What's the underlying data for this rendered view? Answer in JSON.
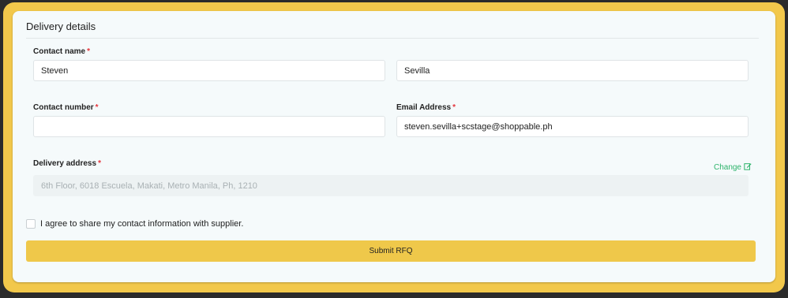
{
  "card": {
    "title": "Delivery details"
  },
  "fields": {
    "contact_name": {
      "label": "Contact name",
      "required_mark": "*",
      "first_value": "Steven",
      "last_value": "Sevilla"
    },
    "contact_number": {
      "label": "Contact number",
      "required_mark": "*",
      "value": ""
    },
    "email": {
      "label": "Email Address",
      "required_mark": "*",
      "value": "steven.sevilla+scstage@shoppable.ph"
    },
    "delivery_address": {
      "label": "Delivery address",
      "required_mark": "*",
      "value": "6th Floor, 6018 Escuela, Makati, Metro Manila, Ph, 1210",
      "change_label": "Change"
    }
  },
  "agreement": {
    "label": "I agree to share my contact information with supplier.",
    "checked": false
  },
  "submit": {
    "label": "Submit RFQ"
  },
  "colors": {
    "accent": "#f2c84b",
    "required": "#e5343b",
    "link": "#2db36b"
  }
}
